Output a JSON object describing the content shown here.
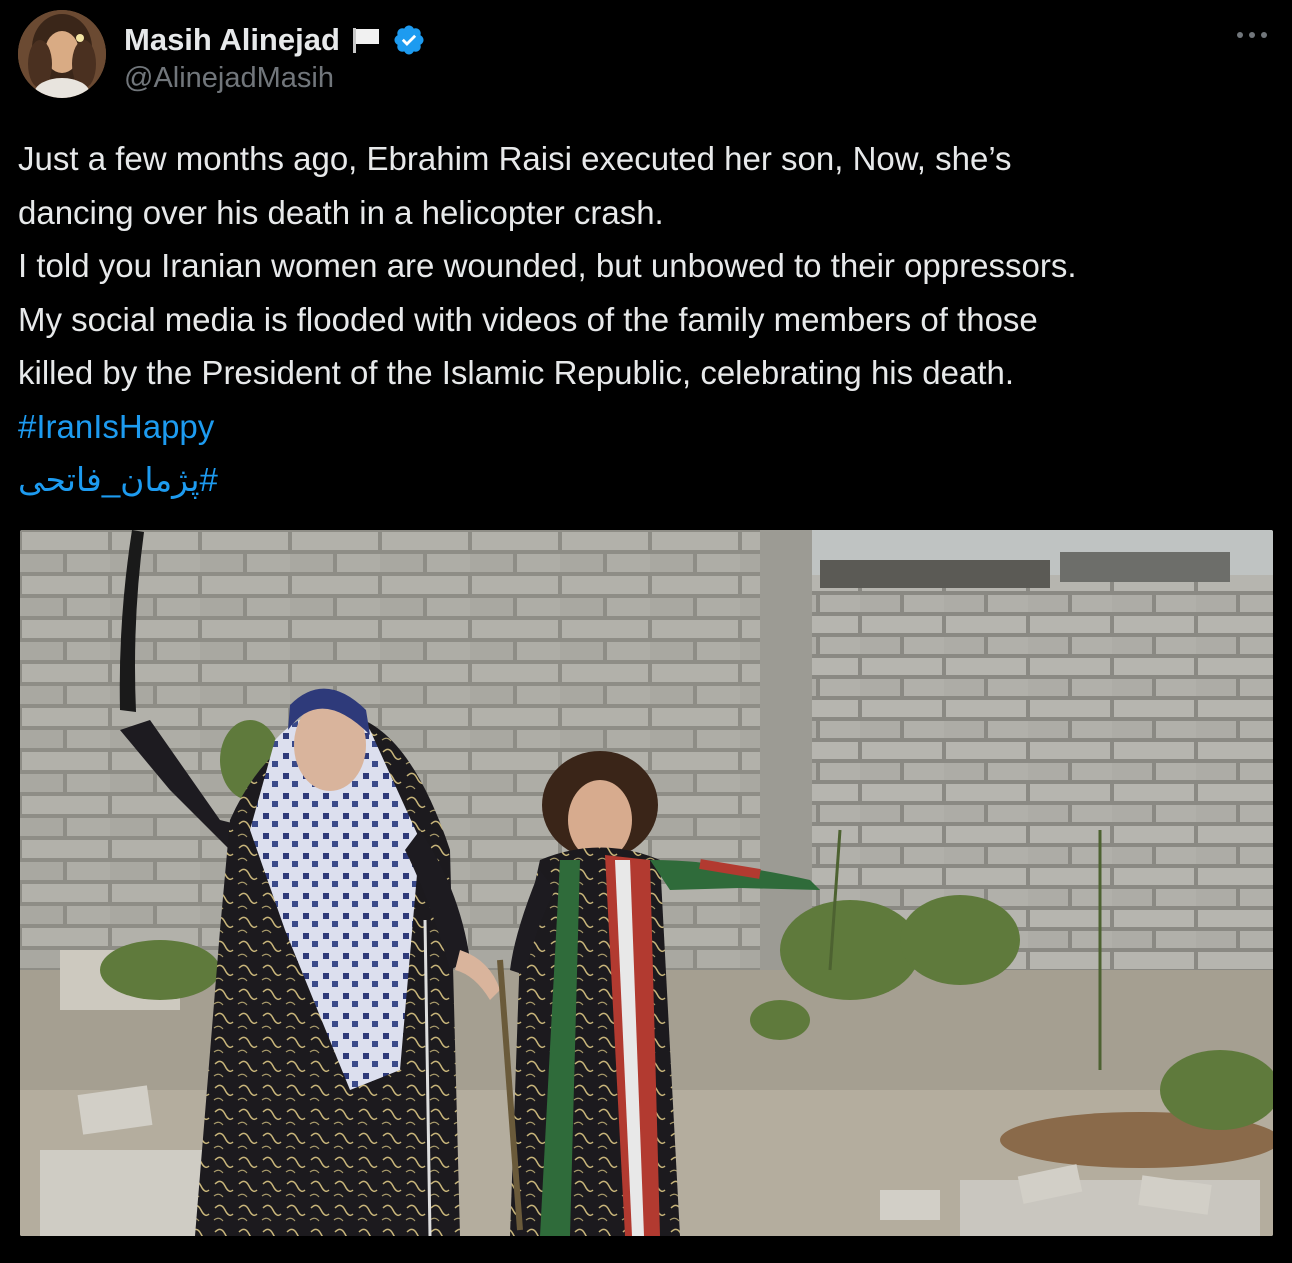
{
  "author": {
    "display_name": "Masih Alinejad",
    "handle": "@AlinejadMasih",
    "flag_icon": "white-flag-icon",
    "verified_icon": "verified-badge-icon",
    "verified_color": "#1d9bf0"
  },
  "more_menu": {
    "icon": "more-horizontal-icon",
    "label": "···"
  },
  "tweet": {
    "lines": [
      "Just a few months ago, Ebrahim Raisi executed her son, Now, she’s",
      "dancing over his death in a helicopter crash.",
      "I told you Iranian women are wounded, but unbowed to their oppressors.",
      "My social media is flooded with videos of the family members of those",
      "killed by the President of the Islamic Republic, celebrating his death."
    ],
    "hashtags": [
      "#IranIsHappy",
      "#پژمان_فاتحی"
    ]
  },
  "media": {
    "type": "video-still",
    "subject": "two-women-dancing-by-cinderblock-wall"
  },
  "colors": {
    "background": "#000000",
    "text": "#e7e9ea",
    "secondary_text": "#71767b",
    "link": "#1d9bf0"
  }
}
